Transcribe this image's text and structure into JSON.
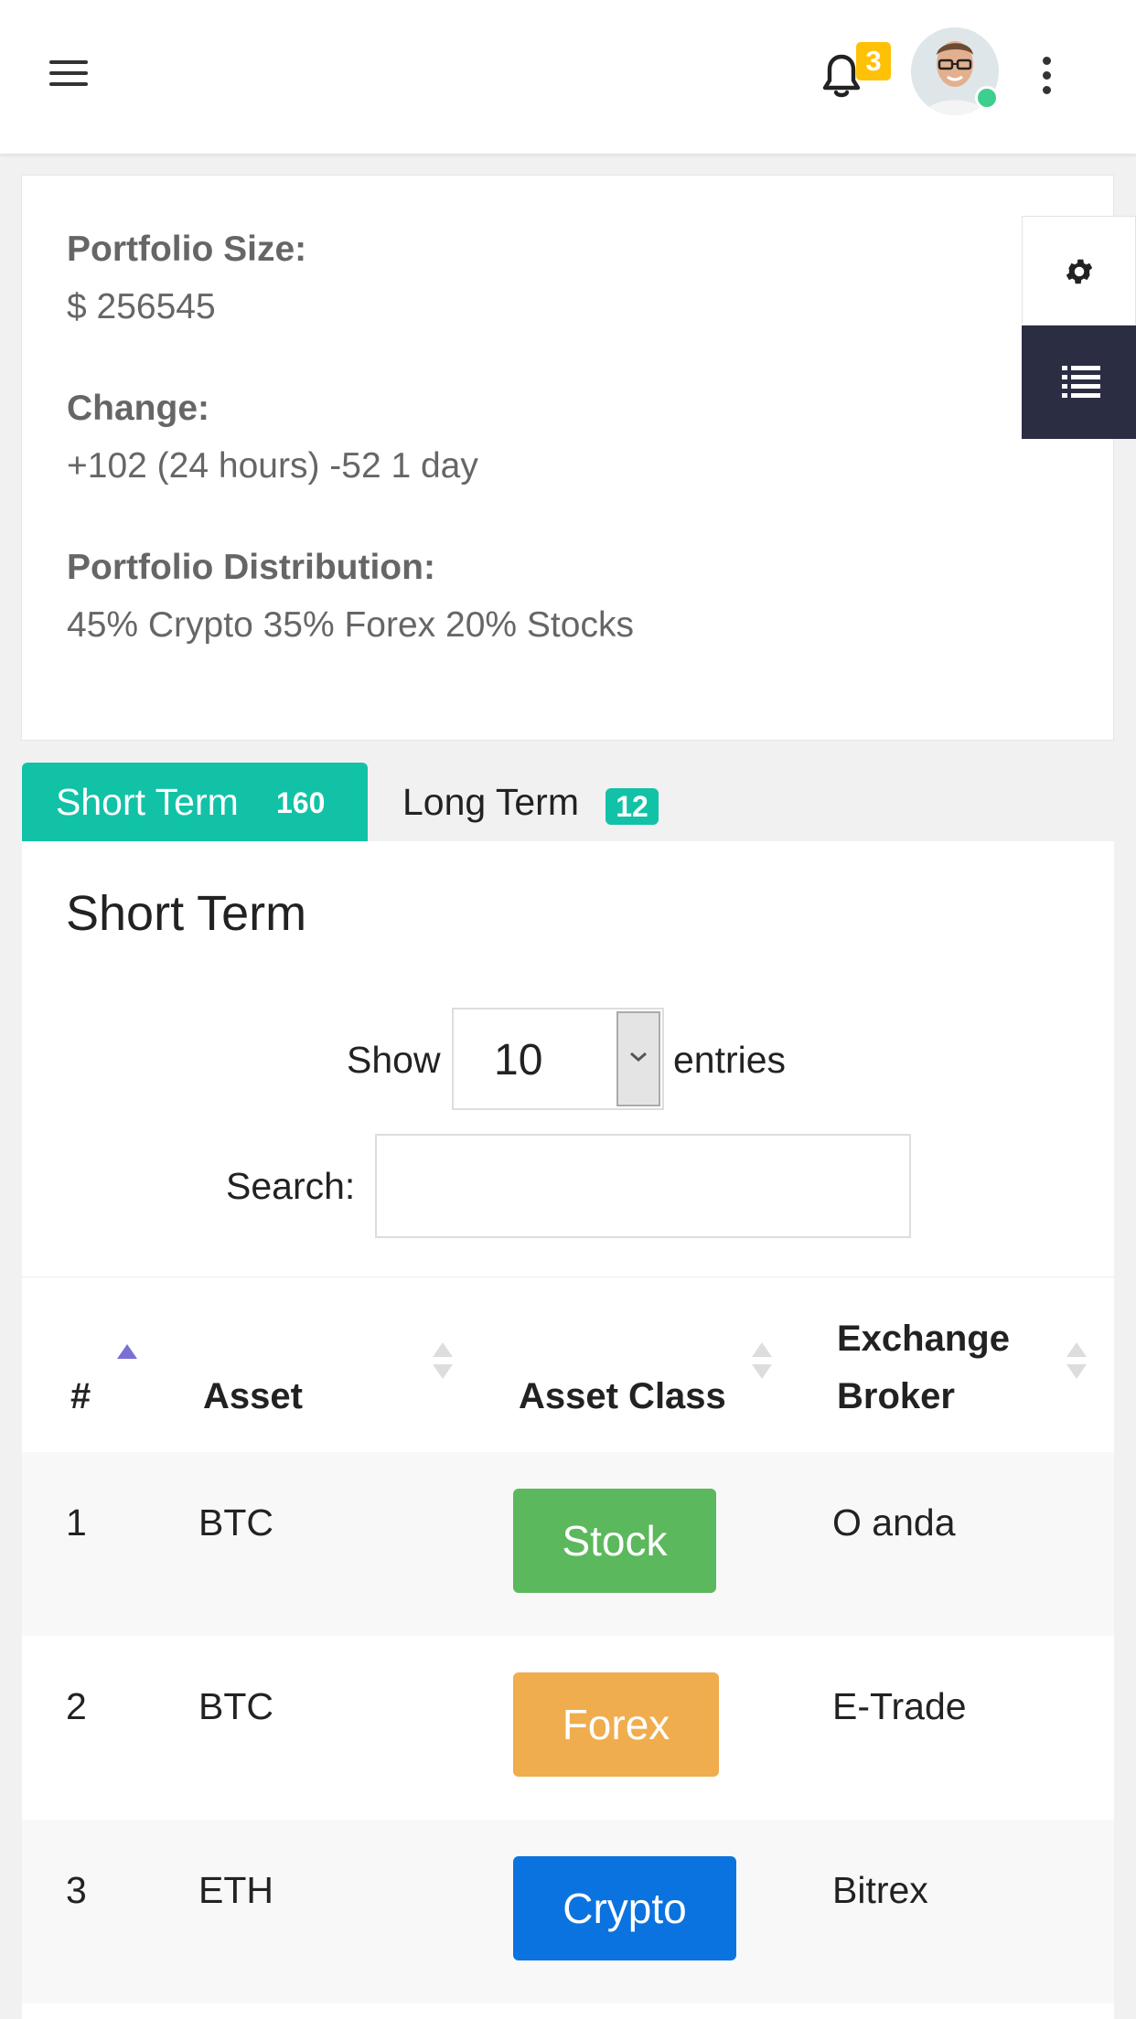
{
  "header": {
    "notification_count": "3",
    "icons": [
      "menu-icon",
      "bell-icon",
      "avatar",
      "more-vertical-icon"
    ]
  },
  "portfolio": {
    "size_label": "Portfolio Size:",
    "size_value": "$ 256545",
    "change_label": "Change:",
    "change_value": "+102 (24 hours) -52 1 day",
    "distribution_label": "Portfolio Distribution:",
    "distribution_value": "45% Crypto 35% Forex 20% Stocks"
  },
  "side_panel": {
    "icons": [
      "gear-icon",
      "list-icon"
    ]
  },
  "tabs": [
    {
      "label": "Short Term",
      "count": "160",
      "active": true
    },
    {
      "label": "Long Term",
      "count": "12",
      "active": false
    }
  ],
  "section": {
    "title": "Short Term",
    "show_label": "Show",
    "entries_value": "10",
    "entries_label": "entries",
    "search_label": "Search:",
    "search_value": ""
  },
  "table": {
    "columns": [
      "#",
      "Asset",
      "Asset Class",
      "Exchange",
      "Broker"
    ],
    "rows": [
      {
        "num": "1",
        "asset": "BTC",
        "asset_class": "Stock",
        "broker": "O anda"
      },
      {
        "num": "2",
        "asset": "BTC",
        "asset_class": "Forex",
        "broker": "E-Trade"
      },
      {
        "num": "3",
        "asset": "ETH",
        "asset_class": "Crypto",
        "broker": "Bitrex"
      }
    ]
  },
  "colors": {
    "accent": "#12c2a6",
    "notification_badge": "#ffc107",
    "online": "#3ecf8e",
    "sidebar_dark": "#2b2d42",
    "stock": "#5cb85c",
    "forex": "#f0ad4e",
    "crypto": "#0a73e0",
    "sort_active": "#7b6fd6"
  }
}
